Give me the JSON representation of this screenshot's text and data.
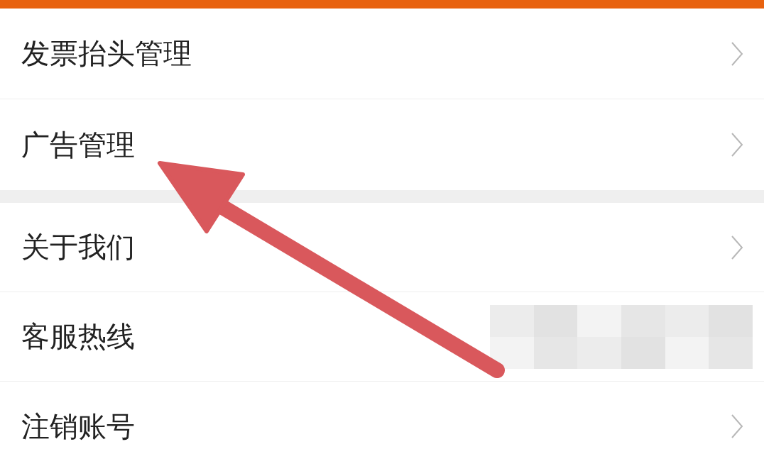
{
  "sections": [
    {
      "items": [
        {
          "kind": "link",
          "label": "发票抬头管理"
        },
        {
          "kind": "link",
          "label": "广告管理"
        }
      ]
    },
    {
      "items": [
        {
          "kind": "link",
          "label": "关于我们"
        },
        {
          "kind": "redacted",
          "label": "客服热线"
        },
        {
          "kind": "link",
          "label": "注销账号"
        }
      ]
    }
  ]
}
